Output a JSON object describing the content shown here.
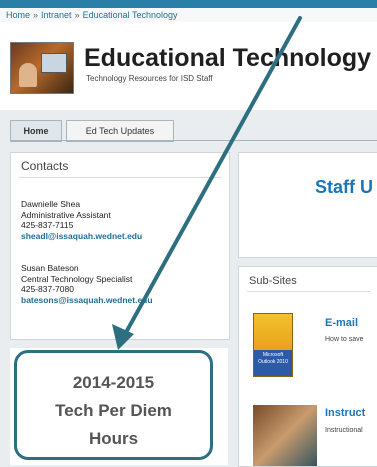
{
  "breadcrumb": [
    "Home",
    "Intranet",
    "Educational Technology"
  ],
  "header": {
    "title": "Educational Technology",
    "subtitle": "Technology Resources for ISD Staff"
  },
  "tabs": [
    {
      "label": "Home",
      "active": true
    },
    {
      "label": "Ed Tech Updates",
      "active": false
    }
  ],
  "contacts": {
    "title": "Contacts",
    "people": [
      {
        "name": "Dawnielle Shea",
        "role": "Administrative Assistant",
        "phone": "425-837-7115",
        "email": "sheadl@issaquah.wednet.edu"
      },
      {
        "name": "Susan Bateson",
        "role": "Central Technology Specialist",
        "phone": "425-837-7080",
        "email": "batesons@issaquah.wednet.edu"
      }
    ]
  },
  "perdiem": {
    "line1": "2014-2015",
    "line2": "Tech Per Diem",
    "line3": "Hours"
  },
  "staff_link": "Staff U",
  "subsites": {
    "title": "Sub-Sites",
    "items": [
      {
        "title": "E-mail",
        "desc": "How to save",
        "icon_text": "Microsoft Outlook 2010"
      },
      {
        "title": "Instruct",
        "desc": "Instructional"
      }
    ]
  },
  "colors": {
    "topbar": "#2a7fa8",
    "accent_link": "#1a76b8",
    "arrow": "#2d6f80"
  }
}
